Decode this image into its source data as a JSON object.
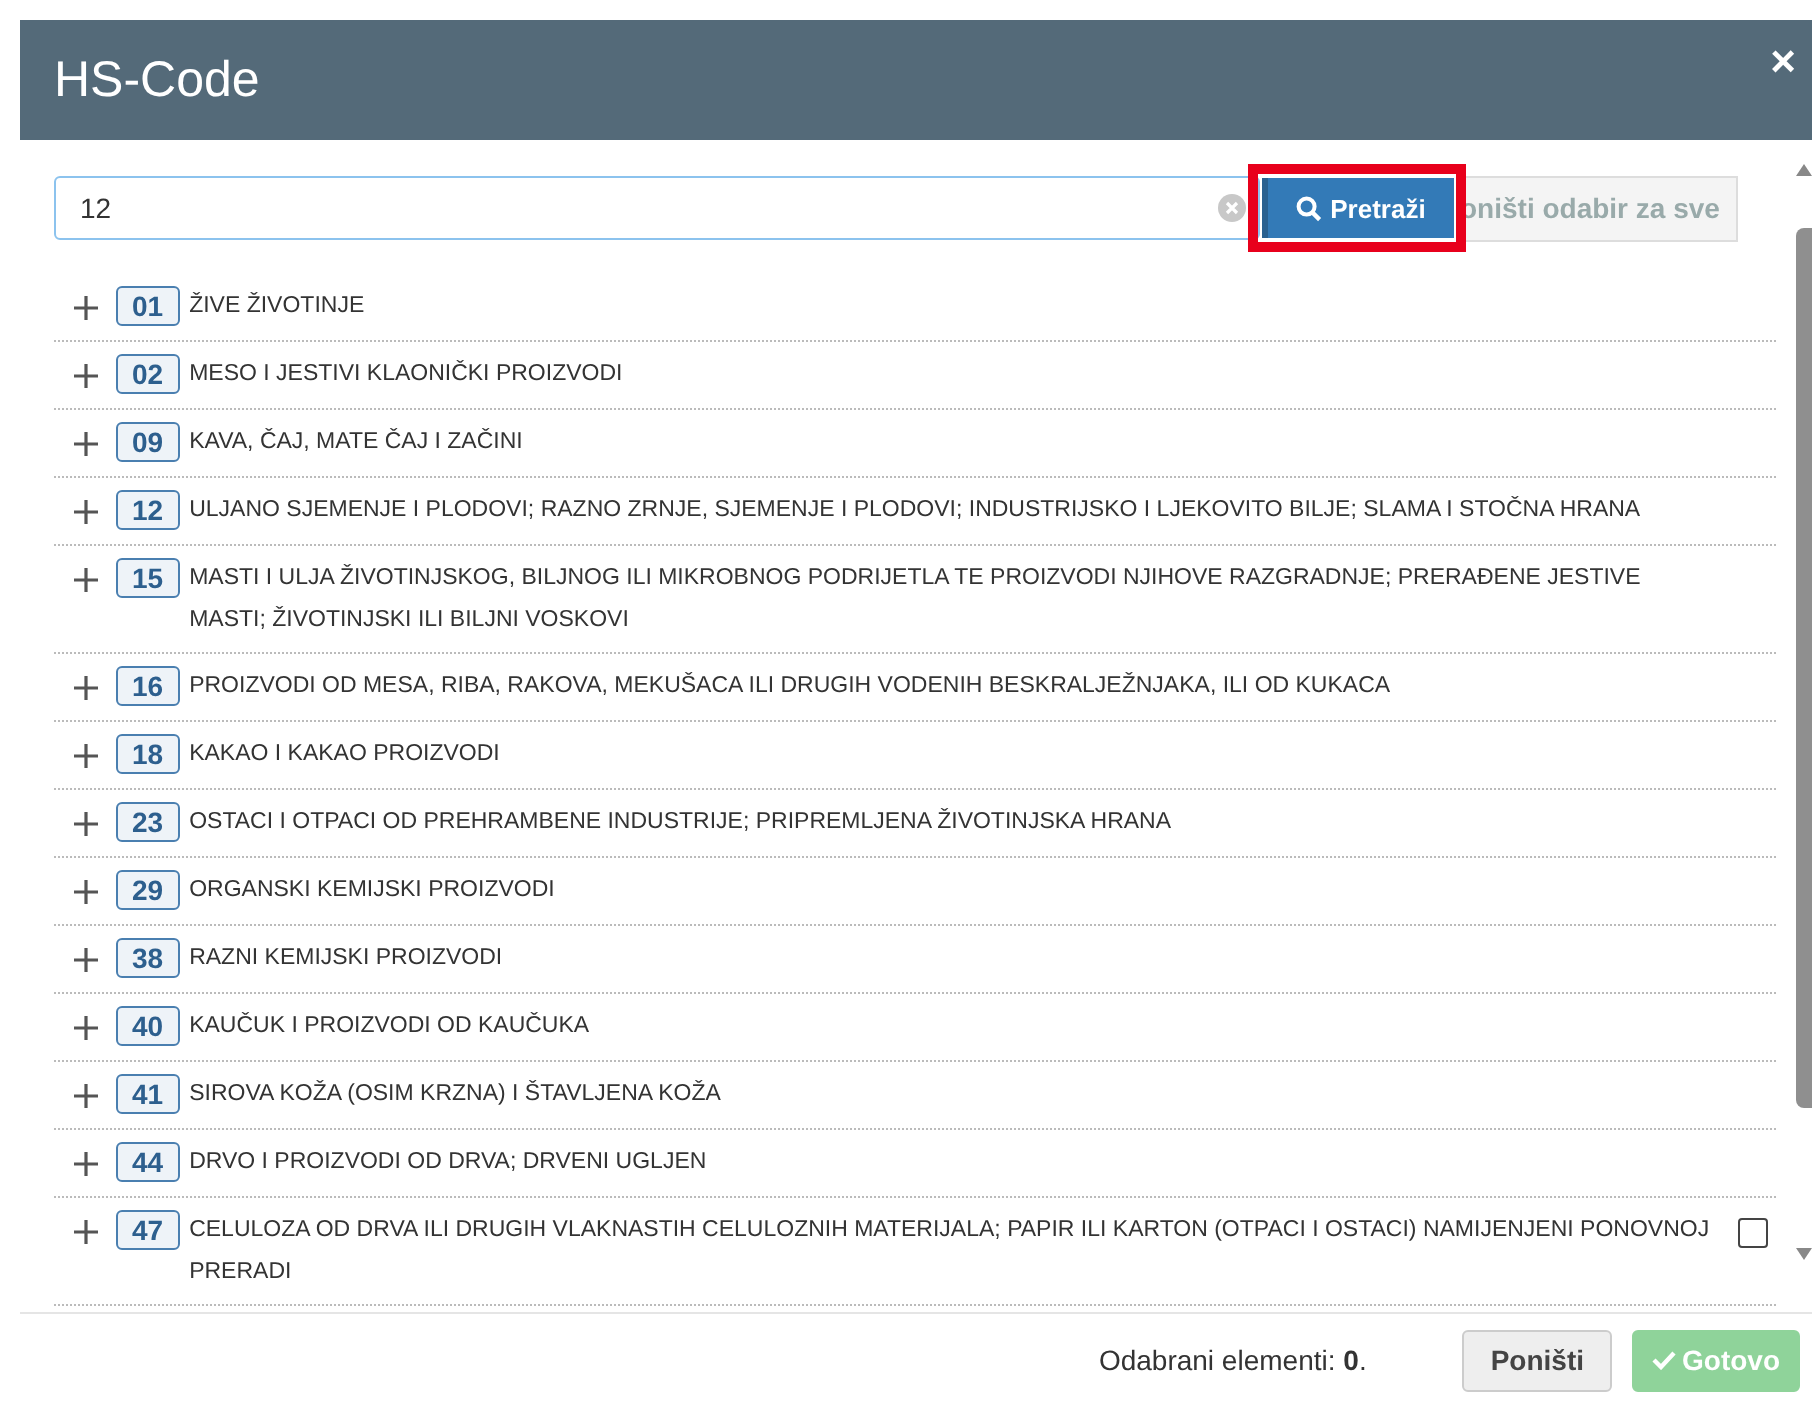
{
  "dialog": {
    "title": "HS-Code",
    "close": "×"
  },
  "search": {
    "value": "12",
    "button": {
      "label": "Pretraži",
      "highlighted": true
    },
    "clear_all": "oništi odabir za sve"
  },
  "rows": [
    {
      "code": "01",
      "text": "ŽIVE ŽIVOTINJE",
      "kind": "plain"
    },
    {
      "code": "02",
      "text": "MESO I JESTIVI KLAONIČKI PROIZVODI",
      "kind": "plain"
    },
    {
      "code": "09",
      "text": "KAVA, ČAJ, MATE ČAJ I ZAČINI",
      "kind": "plain"
    },
    {
      "code": "12",
      "text": "ULJANO SJEMENJE I PLODOVI; RAZNO ZRNJE, SJEMENJE I PLODOVI; INDUSTRIJSKO I LJEKOVITO BILJE; SLAMA I STOČNA HRANA",
      "kind": "plain"
    },
    {
      "code": "15",
      "text": "MASTI I ULJA ŽIVOTINJSKOG, BILJNOG ILI MIKROBNOG PODRIJETLA TE PROIZVODI NJIHOVE RAZGRADNJE; PRERAĐENE JESTIVE MASTI; ŽIVOTINJSKI ILI BILJNI VOSKOVI",
      "kind": "plain"
    },
    {
      "code": "16",
      "text": "PROIZVODI OD MESA, RIBA, RAKOVA, MEKUŠACA ILI DRUGIH VODENIH BESKRALJEŽNJAKA, ILI OD KUKACA",
      "kind": "plain"
    },
    {
      "code": "18",
      "text": "KAKAO I KAKAO PROIZVODI",
      "kind": "plain"
    },
    {
      "code": "23",
      "text": "OSTACI I OTPACI OD PREHRAMBENE INDUSTRIJE; PRIPREMLJENA ŽIVOTINJSKA HRANA",
      "kind": "plain"
    },
    {
      "code": "29",
      "text": "ORGANSKI KEMIJSKI PROIZVODI",
      "kind": "plain"
    },
    {
      "code": "38",
      "text": "RAZNI KEMIJSKI PROIZVODI",
      "kind": "plain"
    },
    {
      "code": "40",
      "text": "KAUČUK I PROIZVODI OD KAUČUKA",
      "kind": "plain"
    },
    {
      "code": "41",
      "text": "SIROVA KOŽA (OSIM KRZNA) I ŠTAVLJENA KOŽA",
      "kind": "plain"
    },
    {
      "code": "44",
      "text": "DRVO I PROIZVODI OD DRVA; DRVENI UGLJEN",
      "kind": "plain"
    },
    {
      "code": "47",
      "text": "CELULOZA OD DRVA ILI DRUGIH VLAKNASTIH CELULOZNIH MATERIJALA; PAPIR ILI KARTON (OTPACI I OSTACI) NAMIJENJENI PONOVNOJ PRERADI",
      "kind": "selectable",
      "checked": false
    }
  ],
  "footer": {
    "count_label": "Odabrani elementi: ",
    "count": "0",
    "count_end": ".",
    "cancel": "Poništi",
    "done": "Gotovo"
  }
}
